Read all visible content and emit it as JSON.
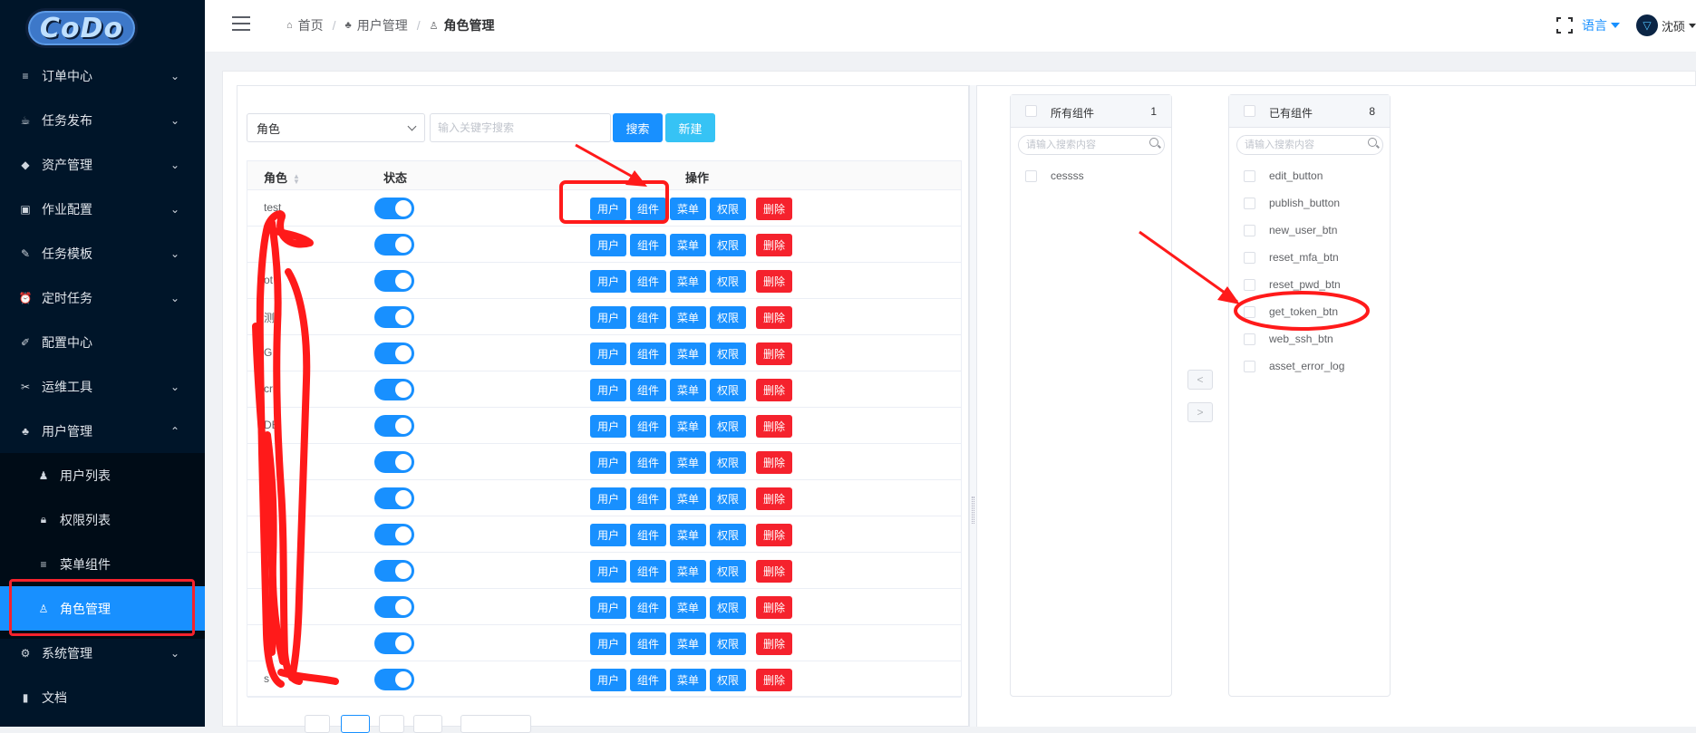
{
  "sidebar": {
    "logo_text": "CoDo",
    "items": [
      {
        "label": "订单中心",
        "icon": "list-icon"
      },
      {
        "label": "任务发布",
        "icon": "cup-icon"
      },
      {
        "label": "资产管理",
        "icon": "cube-icon"
      },
      {
        "label": "作业配置",
        "icon": "printer-icon"
      },
      {
        "label": "任务模板",
        "icon": "magic-icon"
      },
      {
        "label": "定时任务",
        "icon": "alarm-icon"
      },
      {
        "label": "配置中心",
        "icon": "pencil-icon"
      },
      {
        "label": "运维工具",
        "icon": "tools-icon"
      },
      {
        "label": "用户管理",
        "icon": "users-icon"
      },
      {
        "label": "用户列表",
        "icon": "user-list-icon"
      },
      {
        "label": "权限列表",
        "icon": "lock-icon"
      },
      {
        "label": "菜单组件",
        "icon": "menu-icon"
      },
      {
        "label": "角色管理",
        "icon": "user-icon"
      },
      {
        "label": "系统管理",
        "icon": "gear-icon"
      },
      {
        "label": "文档",
        "icon": "book-icon"
      }
    ]
  },
  "header": {
    "breadcrumb": [
      "首页",
      "用户管理",
      "角色管理"
    ],
    "language": "语言",
    "username": "沈硕"
  },
  "toolbar": {
    "select_value": "角色",
    "search_placeholder": "输入关键字搜索",
    "search_label": "搜索",
    "new_label": "新建"
  },
  "table": {
    "columns": [
      "角色",
      "状态",
      "操作"
    ],
    "action_labels": {
      "user": "用户",
      "component": "组件",
      "menu": "菜单",
      "permission": "权限",
      "delete": "删除"
    },
    "rows": [
      {
        "name": "test",
        "enabled": true
      },
      {
        "name": "",
        "enabled": true
      },
      {
        "name": "ot",
        "enabled": true
      },
      {
        "name": "测",
        "enabled": true
      },
      {
        "name": "G",
        "enabled": true
      },
      {
        "name": "cr",
        "enabled": true
      },
      {
        "name": "DB",
        "enabled": true
      },
      {
        "name": "",
        "enabled": true
      },
      {
        "name": "",
        "enabled": true
      },
      {
        "name": "shi",
        "enabled": true
      },
      {
        "name": "",
        "enabled": true
      },
      {
        "name": "",
        "enabled": true
      },
      {
        "name": "",
        "enabled": true
      },
      {
        "name": "s",
        "enabled": true
      }
    ]
  },
  "transfer": {
    "left": {
      "title": "所有组件",
      "count": "1",
      "placeholder": "请输入搜索内容",
      "items": [
        "cessss"
      ]
    },
    "right": {
      "title": "已有组件",
      "count": "8",
      "placeholder": "请输入搜索内容",
      "items": [
        "edit_button",
        "publish_button",
        "new_user_btn",
        "reset_mfa_btn",
        "reset_pwd_btn",
        "get_token_btn",
        "web_ssh_btn",
        "asset_error_log"
      ]
    },
    "move_left": "<",
    "move_right": ">"
  },
  "colors": {
    "sidebar_bg": "#001529",
    "primary": "#1890ff",
    "danger": "#f5222d",
    "annotation": "#ff1a1a"
  }
}
